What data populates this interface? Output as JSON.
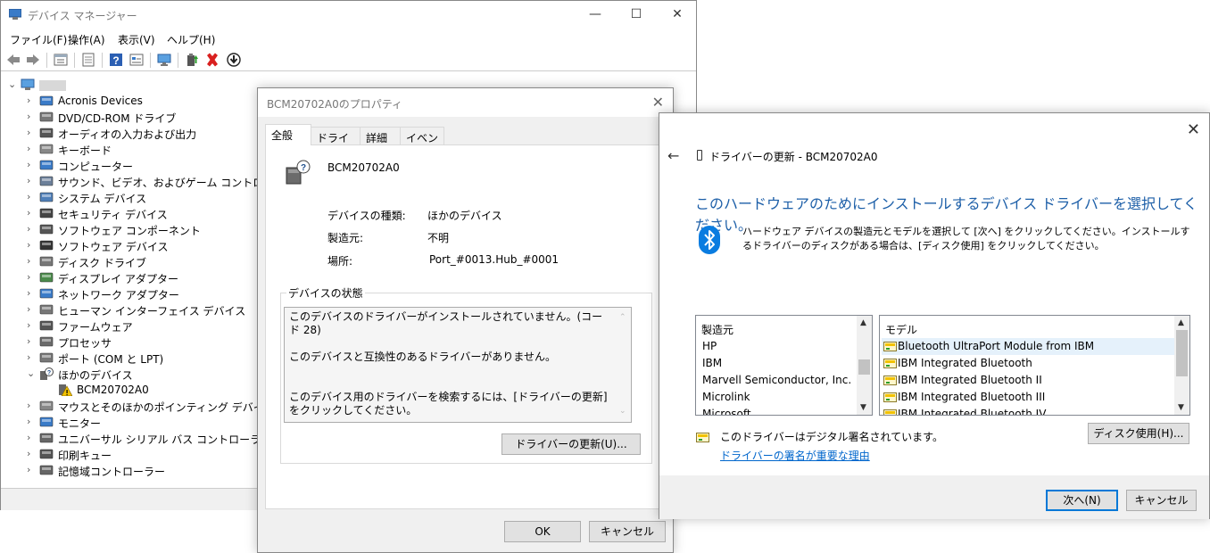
{
  "device_manager": {
    "title": "デバイス マネージャー",
    "window_controls": {
      "minimize": "—",
      "maximize": "☐",
      "close": "✕"
    },
    "menu": [
      "ファイル(F)",
      "操作(A)",
      "表示(V)",
      "ヘルプ(H)"
    ],
    "toolbar_icons": [
      "back-icon",
      "forward-icon",
      "properties-icon",
      "list-icon",
      "help-icon",
      "view-icon",
      "monitor-icon",
      "update-driver-icon",
      "uninstall-icon",
      "download-icon"
    ],
    "tree": {
      "root_label": "",
      "items": [
        {
          "label": "Acronis Devices",
          "icon": "monitor-icon",
          "expanded": false
        },
        {
          "label": "DVD/CD-ROM ドライブ",
          "icon": "dvd-icon",
          "expanded": false
        },
        {
          "label": "オーディオの入力および出力",
          "icon": "speaker-icon",
          "expanded": false
        },
        {
          "label": "キーボード",
          "icon": "keyboard-icon",
          "expanded": false
        },
        {
          "label": "コンピューター",
          "icon": "computer-icon",
          "expanded": false
        },
        {
          "label": "サウンド、ビデオ、およびゲーム コントローラー",
          "icon": "sound-icon",
          "expanded": false
        },
        {
          "label": "システム デバイス",
          "icon": "system-icon",
          "expanded": false
        },
        {
          "label": "セキュリティ デバイス",
          "icon": "security-icon",
          "expanded": false
        },
        {
          "label": "ソフトウェア コンポーネント",
          "icon": "software-component-icon",
          "expanded": false
        },
        {
          "label": "ソフトウェア デバイス",
          "icon": "software-device-icon",
          "expanded": false
        },
        {
          "label": "ディスク ドライブ",
          "icon": "disk-icon",
          "expanded": false
        },
        {
          "label": "ディスプレイ アダプター",
          "icon": "display-adapter-icon",
          "expanded": false
        },
        {
          "label": "ネットワーク アダプター",
          "icon": "network-icon",
          "expanded": false
        },
        {
          "label": "ヒューマン インターフェイス デバイス",
          "icon": "hid-icon",
          "expanded": false
        },
        {
          "label": "ファームウェア",
          "icon": "firmware-icon",
          "expanded": false
        },
        {
          "label": "プロセッサ",
          "icon": "processor-icon",
          "expanded": false
        },
        {
          "label": "ポート (COM と LPT)",
          "icon": "port-icon",
          "expanded": false
        },
        {
          "label": "ほかのデバイス",
          "icon": "unknown-device-icon",
          "expanded": true
        },
        {
          "label": "BCM20702A0",
          "icon": "warning-device-icon",
          "child": true
        },
        {
          "label": "マウスとそのほかのポインティング デバイス",
          "icon": "mouse-icon",
          "expanded": false
        },
        {
          "label": "モニター",
          "icon": "monitor-icon",
          "expanded": false
        },
        {
          "label": "ユニバーサル シリアル バス コントローラー",
          "icon": "usb-icon",
          "expanded": false
        },
        {
          "label": "印刷キュー",
          "icon": "printer-icon",
          "expanded": false
        },
        {
          "label": "記憶域コントローラー",
          "icon": "storage-icon",
          "expanded": false
        }
      ]
    }
  },
  "properties": {
    "title": "BCM20702A0のプロパティ",
    "close": "✕",
    "tabs": [
      "全般",
      "ドライバー",
      "詳細",
      "イベント"
    ],
    "device_name": "BCM20702A0",
    "fields": [
      {
        "label": "デバイスの種類:",
        "value": "ほかのデバイス"
      },
      {
        "label": "製造元:",
        "value": "不明"
      },
      {
        "label": "場所:",
        "value": "Port_#0013.Hub_#0001"
      }
    ],
    "status_group_title": "デバイスの状態",
    "status_lines": [
      "このデバイスのドライバーがインストールされていません。(コード 28)",
      "このデバイスと互換性のあるドライバーがありません。",
      "このデバイス用のドライバーを検索するには、[ドライバーの更新] をクリックしてください。"
    ],
    "update_button": "ドライバーの更新(U)...",
    "ok_button": "OK",
    "cancel_button": "キャンセル"
  },
  "wizard": {
    "close": "✕",
    "back": "←",
    "header": "ドライバーの更新 - BCM20702A0",
    "heading": "このハードウェアのためにインストールするデバイス ドライバーを選択してください。",
    "description": "ハードウェア デバイスの製造元とモデルを選択して [次へ] をクリックしてください。インストールするドライバーのディスクがある場合は、[ディスク使用] をクリックしてください。",
    "manufacturer_header": "製造元",
    "manufacturers": [
      "HP",
      "IBM",
      "Marvell Semiconductor, Inc.",
      "Microlink",
      "Microsoft"
    ],
    "model_header": "モデル",
    "models": [
      "Bluetooth UltraPort Module from IBM",
      "IBM Integrated Bluetooth",
      "IBM Integrated Bluetooth II",
      "IBM Integrated Bluetooth III",
      "IBM Integrated Bluetooth IV"
    ],
    "selected_model_index": 0,
    "signed_text": "このドライバーはデジタル署名されています。",
    "signing_link": "ドライバーの署名が重要な理由",
    "disk_button": "ディスク使用(H)...",
    "next_button": "次へ(N)",
    "cancel_button": "キャンセル"
  },
  "colors": {
    "accent": "#0078d7",
    "heading_blue": "#1d5fa8",
    "link": "#0066cc",
    "bluetooth": "#0a7ce0",
    "delete_red": "#d9201f",
    "warning_yellow": "#f2c200"
  }
}
